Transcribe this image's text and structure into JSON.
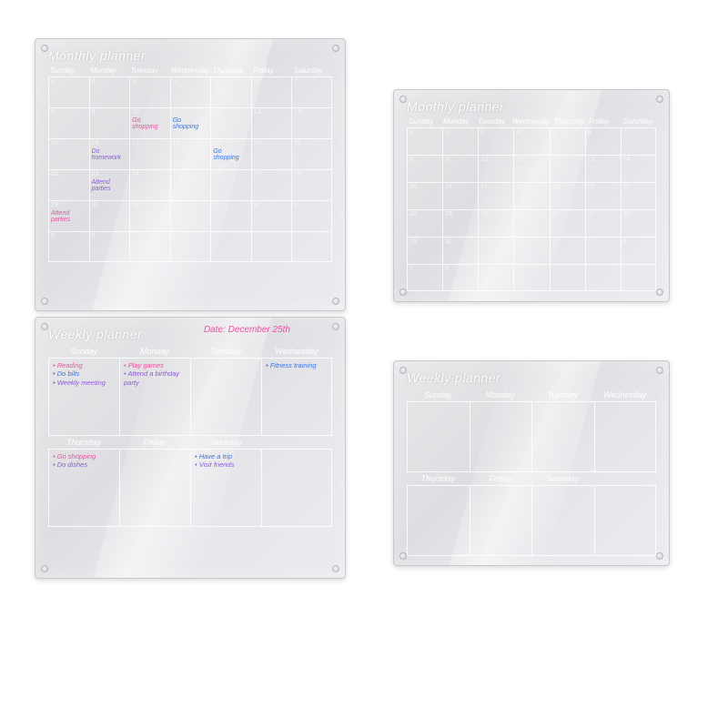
{
  "monthly": {
    "title": "Monthly planner",
    "days": [
      "Sunday",
      "Monday",
      "Tuesday",
      "Wednesday",
      "Thursday",
      "Friday",
      "Saturday"
    ],
    "entries": {
      "10": {
        "text": "Go shopping",
        "color": "pink"
      },
      "11": {
        "text": "Go shopping",
        "color": "blue"
      },
      "16": {
        "text": "Do homework",
        "color": "purple"
      },
      "19": {
        "text": "Go shopping",
        "color": "blue"
      },
      "23": {
        "text": "Attend parties",
        "color": "purple"
      },
      "29": {
        "text": "Attend parties",
        "color": "pink"
      }
    }
  },
  "weekly": {
    "title": "Weekly planner",
    "date_label": "Date: December 25th",
    "row1_days": [
      "Sunday",
      "Monday",
      "Tuesday",
      "Wednesday"
    ],
    "row2_days": [
      "Thursday",
      "Friday",
      "Saturday",
      ""
    ],
    "cells_row1": [
      {
        "items": [
          {
            "t": "Reading",
            "c": "pink"
          },
          {
            "t": "Do bills",
            "c": "blue"
          },
          {
            "t": "Weekly meeting",
            "c": "purple"
          }
        ]
      },
      {
        "items": [
          {
            "t": "Play games",
            "c": "pink"
          },
          {
            "t": "Attend a birthday party",
            "c": "purple"
          }
        ]
      },
      {
        "items": []
      },
      {
        "items": [
          {
            "t": "Fitness training",
            "c": "blue"
          }
        ]
      }
    ],
    "cells_row2": [
      {
        "items": [
          {
            "t": "Go shopping",
            "c": "pink"
          },
          {
            "t": "Do dishes",
            "c": "purple"
          }
        ]
      },
      {
        "items": []
      },
      {
        "items": [
          {
            "t": "Have a trip",
            "c": "blue"
          },
          {
            "t": "Visit friends",
            "c": "purple"
          }
        ]
      },
      {
        "items": []
      }
    ]
  }
}
